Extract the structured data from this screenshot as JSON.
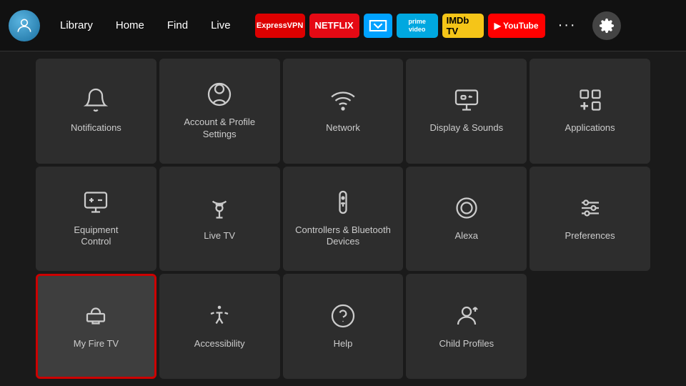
{
  "nav": {
    "links": [
      "Library",
      "Home",
      "Find",
      "Live"
    ],
    "apps": [
      {
        "name": "ExpressVPN",
        "class": "app-expressvpn",
        "text": "Express VPN"
      },
      {
        "name": "Netflix",
        "class": "app-netflix",
        "text": "NETFLIX"
      },
      {
        "name": "Freevee",
        "class": "app-freevee",
        "text": "≫"
      },
      {
        "name": "Prime Video",
        "class": "app-prime",
        "text": "prime video"
      },
      {
        "name": "IMDb TV",
        "class": "app-imdb",
        "text": "IMDb TV"
      },
      {
        "name": "YouTube",
        "class": "app-youtube",
        "text": "▶ YouTube"
      }
    ]
  },
  "grid": {
    "items": [
      {
        "id": "notifications",
        "label": "Notifications",
        "icon": "bell"
      },
      {
        "id": "account-profile",
        "label": "Account & Profile\nSettings",
        "icon": "person-circle"
      },
      {
        "id": "network",
        "label": "Network",
        "icon": "wifi"
      },
      {
        "id": "display-sounds",
        "label": "Display & Sounds",
        "icon": "display-sound"
      },
      {
        "id": "applications",
        "label": "Applications",
        "icon": "apps"
      },
      {
        "id": "equipment-control",
        "label": "Equipment\nControl",
        "icon": "monitor"
      },
      {
        "id": "live-tv",
        "label": "Live TV",
        "icon": "antenna"
      },
      {
        "id": "controllers-bluetooth",
        "label": "Controllers & Bluetooth\nDevices",
        "icon": "remote"
      },
      {
        "id": "alexa",
        "label": "Alexa",
        "icon": "alexa"
      },
      {
        "id": "preferences",
        "label": "Preferences",
        "icon": "sliders"
      },
      {
        "id": "my-fire-tv",
        "label": "My Fire TV",
        "icon": "fire-tv",
        "selected": true
      },
      {
        "id": "accessibility",
        "label": "Accessibility",
        "icon": "accessibility"
      },
      {
        "id": "help",
        "label": "Help",
        "icon": "help"
      },
      {
        "id": "child-profiles",
        "label": "Child Profiles",
        "icon": "child-profiles"
      }
    ]
  }
}
